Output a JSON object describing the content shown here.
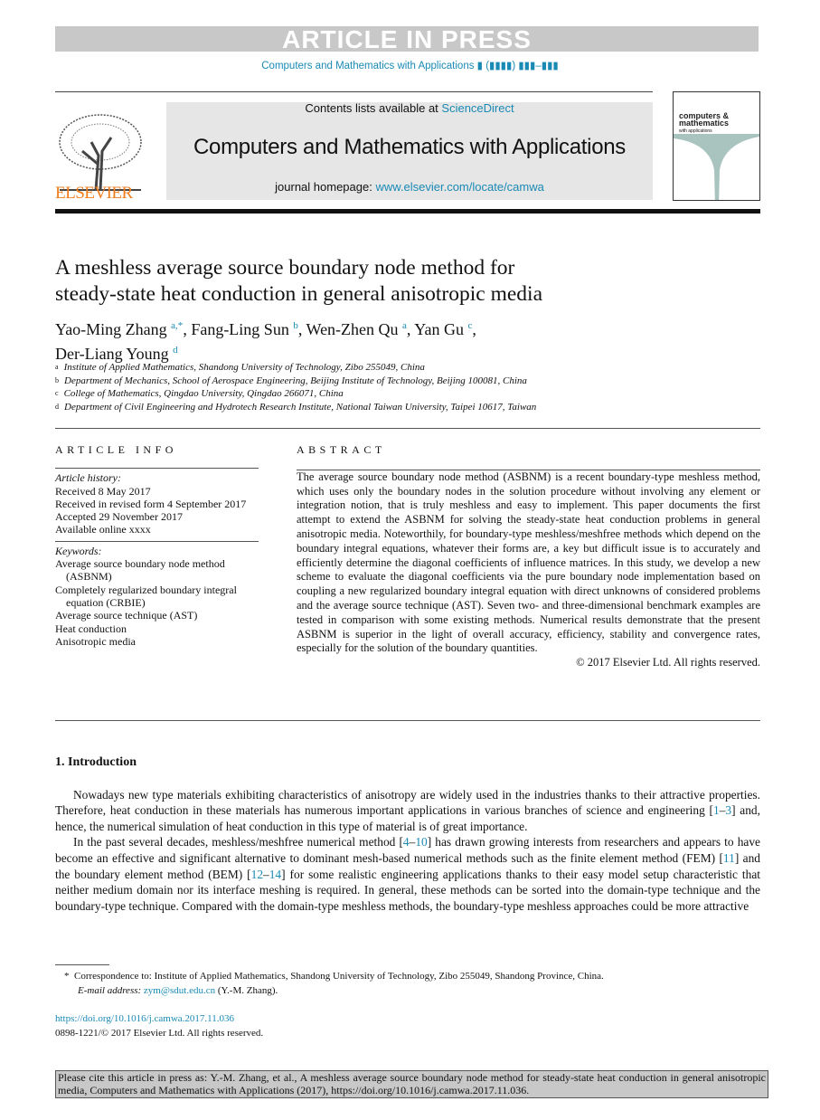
{
  "banner_top": "ARTICLE IN PRESS",
  "journal_ref": "Computers and Mathematics with Applications ▮ (▮▮▮▮) ▮▮▮–▮▮▮",
  "header": {
    "contents_prefix": "Contents lists available at ",
    "sciencedirect": "ScienceDirect",
    "journal_title": "Computers and Mathematics with Applications",
    "homepage_prefix": "journal homepage: ",
    "homepage_url": "www.elsevier.com/locate/camwa",
    "publisher": "ELSEVIER",
    "cover_title": "computers & mathematics",
    "cover_sub": "with applications"
  },
  "title_lines": [
    "A meshless average source boundary node method for",
    "steady-state heat conduction in general anisotropic media"
  ],
  "authors": [
    {
      "name": "Yao-Ming Zhang",
      "sup": "a,*",
      "sep": ", "
    },
    {
      "name": "Fang-Ling Sun",
      "sup": "b",
      "sep": ", "
    },
    {
      "name": "Wen-Zhen Qu",
      "sup": "a",
      "sep": ", "
    },
    {
      "name": "Yan Gu",
      "sup": "c",
      "sep": ","
    },
    {
      "name": "Der-Liang Young",
      "sup": "d",
      "sep": ""
    }
  ],
  "affiliations": [
    {
      "mark": "a",
      "text": "Institute of Applied Mathematics, Shandong University of Technology, Zibo 255049, China"
    },
    {
      "mark": "b",
      "text": "Department of Mechanics, School of Aerospace Engineering, Beijing Institute of Technology, Beijing 100081, China"
    },
    {
      "mark": "c",
      "text": "College of Mathematics, Qingdao University, Qingdao 266071, China"
    },
    {
      "mark": "d",
      "text": "Department of Civil Engineering and Hydrotech Research Institute, National Taiwan University, Taipei 10617, Taiwan"
    }
  ],
  "article_info": {
    "heading": "ARTICLE INFO",
    "history_label": "Article history:",
    "history": [
      "Received 8 May 2017",
      "Received in revised form 4 September 2017",
      "Accepted 29 November 2017",
      "Available online xxxx"
    ],
    "keywords_label": "Keywords:",
    "keywords": [
      "Average source boundary node method (ASBNM)",
      "Completely regularized boundary integral equation (CRBIE)",
      "Average source technique (AST)",
      "Heat conduction",
      "Anisotropic media"
    ]
  },
  "abstract": {
    "heading": "ABSTRACT",
    "text": "The average source boundary node method (ASBNM) is a recent boundary-type meshless method, which uses only the boundary nodes in the solution procedure without involving any element or integration notion, that is truly meshless and easy to implement. This paper documents the first attempt to extend the ASBNM for solving the steady-state heat conduction problems in general anisotropic media. Noteworthily, for boundary-type meshless/meshfree methods which depend on the boundary integral equations, whatever their forms are, a key but difficult issue is to accurately and efficiently determine the diagonal coefficients of influence matrices. In this study, we develop a new scheme to evaluate the diagonal coefficients via the pure boundary node implementation based on coupling a new regularized boundary integral equation with direct unknowns of considered problems and the average source technique (AST). Seven two- and three-dimensional benchmark examples are tested in comparison with some existing methods. Numerical results demonstrate that the present ASBNM is superior in the light of overall accuracy, efficiency, stability and convergence rates, especially for the solution of the boundary quantities.",
    "copyright": "© 2017 Elsevier Ltd. All rights reserved."
  },
  "intro": {
    "heading": "1.  Introduction",
    "paragraphs": [
      [
        {
          "t": "Nowadays new type materials exhibiting characteristics of anisotropy are widely used in the industries thanks to their attractive properties. Therefore, heat conduction in these materials has numerous important applications in various branches of science and engineering ["
        },
        {
          "t": "1",
          "l": 1
        },
        {
          "t": "–"
        },
        {
          "t": "3",
          "l": 1
        },
        {
          "t": "] and, hence, the numerical simulation of heat conduction in this type of material is of great importance."
        }
      ],
      [
        {
          "t": "In the past several decades, meshless/meshfree numerical method ["
        },
        {
          "t": "4",
          "l": 1
        },
        {
          "t": "–"
        },
        {
          "t": "10",
          "l": 1
        },
        {
          "t": "] has drawn growing interests from researchers and appears to have become an effective and significant alternative to dominant mesh-based numerical methods such as the finite element method (FEM) ["
        },
        {
          "t": "11",
          "l": 1
        },
        {
          "t": "] and the boundary element method (BEM) ["
        },
        {
          "t": "12",
          "l": 1
        },
        {
          "t": "–"
        },
        {
          "t": "14",
          "l": 1
        },
        {
          "t": "] for some realistic engineering applications thanks to their easy model setup characteristic that neither medium domain nor its interface meshing is required. In general, these methods can be sorted into the domain-type technique and the boundary-type technique. Compared with the domain-type meshless methods, the boundary-type meshless approaches could be more attractive"
        }
      ]
    ]
  },
  "footnote": {
    "star": "*",
    "correspondence": "Correspondence to: Institute of Applied Mathematics, Shandong University of Technology, Zibo 255049, Shandong Province, China.",
    "email_label": "E-mail address: ",
    "email": "zym@sdut.edu.cn",
    "email_suffix": " (Y.-M. Zhang).",
    "doi": "https://doi.org/10.1016/j.camwa.2017.11.036",
    "issn": "0898-1221/© 2017 Elsevier Ltd. All rights reserved."
  },
  "cite_box": "Please cite this article in press as: Y.-M. Zhang, et al., A meshless average source boundary node method for steady-state heat conduction in general anisotropic media, Computers and Mathematics with Applications (2017), https://doi.org/10.1016/j.camwa.2017.11.036."
}
